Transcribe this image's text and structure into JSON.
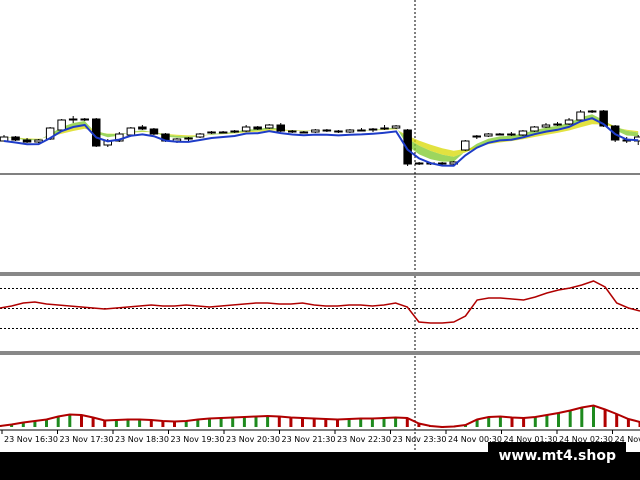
{
  "window": {
    "panels": [
      "main-price-chart",
      "oscillator-1",
      "oscillator-2"
    ]
  },
  "colors": {
    "background": "#ffffff",
    "bull_candle": "#ffffff",
    "bear_candle": "#000000",
    "ema_fast": "#1e3cc8",
    "ribbon_green": "#7cc828",
    "ribbon_yellow": "#d8d800",
    "oscillator_line": "#b00000",
    "histogram_pos": "#1e8a1e",
    "histogram_neg": "#b00000",
    "grid_dotted": "#000000",
    "crosshair": "#000000"
  },
  "x_axis": {
    "labels": [
      "23 Nov 16:30",
      "23 Nov 17:30",
      "23 Nov 18:30",
      "23 Nov 19:30",
      "23 Nov 20:30",
      "23 Nov 21:30",
      "23 Nov 22:30",
      "23 Nov 23:30",
      "24 Nov 00:30",
      "24 Nov 01:30",
      "24 Nov 02:30",
      "24 Nov 0"
    ]
  },
  "watermark": {
    "text": "www.mt4.shop"
  },
  "chart_data": {
    "type": "candlestick",
    "candles": [
      [
        0.48,
        0.6,
        0.47,
        0.56
      ],
      [
        0.56,
        0.58,
        0.48,
        0.5
      ],
      [
        0.5,
        0.54,
        0.44,
        0.46
      ],
      [
        0.46,
        0.52,
        0.44,
        0.5
      ],
      [
        0.52,
        0.76,
        0.5,
        0.74
      ],
      [
        0.7,
        0.92,
        0.66,
        0.9
      ],
      [
        0.9,
        0.98,
        0.84,
        0.92
      ],
      [
        0.92,
        0.94,
        0.88,
        0.92
      ],
      [
        0.92,
        0.94,
        0.36,
        0.38
      ],
      [
        0.4,
        0.52,
        0.36,
        0.48
      ],
      [
        0.48,
        0.66,
        0.46,
        0.62
      ],
      [
        0.6,
        0.76,
        0.58,
        0.74
      ],
      [
        0.76,
        0.8,
        0.7,
        0.72
      ],
      [
        0.72,
        0.74,
        0.6,
        0.62
      ],
      [
        0.62,
        0.64,
        0.46,
        0.48
      ],
      [
        0.48,
        0.54,
        0.44,
        0.52
      ],
      [
        0.52,
        0.56,
        0.48,
        0.54
      ],
      [
        0.56,
        0.64,
        0.54,
        0.62
      ],
      [
        0.64,
        0.68,
        0.62,
        0.66
      ],
      [
        0.66,
        0.68,
        0.64,
        0.66
      ],
      [
        0.66,
        0.7,
        0.64,
        0.68
      ],
      [
        0.68,
        0.8,
        0.66,
        0.76
      ],
      [
        0.76,
        0.78,
        0.7,
        0.72
      ],
      [
        0.74,
        0.82,
        0.72,
        0.8
      ],
      [
        0.8,
        0.84,
        0.66,
        0.68
      ],
      [
        0.68,
        0.7,
        0.64,
        0.66
      ],
      [
        0.66,
        0.68,
        0.64,
        0.66
      ],
      [
        0.66,
        0.72,
        0.64,
        0.7
      ],
      [
        0.7,
        0.72,
        0.66,
        0.68
      ],
      [
        0.68,
        0.7,
        0.64,
        0.66
      ],
      [
        0.66,
        0.72,
        0.64,
        0.7
      ],
      [
        0.7,
        0.74,
        0.68,
        0.7
      ],
      [
        0.7,
        0.74,
        0.66,
        0.72
      ],
      [
        0.72,
        0.8,
        0.7,
        0.74
      ],
      [
        0.74,
        0.8,
        0.72,
        0.78
      ],
      [
        0.7,
        0.72,
        -0.02,
        0.02
      ],
      [
        0.04,
        0.06,
        0.0,
        0.04
      ],
      [
        0.04,
        0.06,
        0.0,
        0.02
      ],
      [
        0.04,
        0.06,
        -0.02,
        0.02
      ],
      [
        0.02,
        0.08,
        0.0,
        0.06
      ],
      [
        0.3,
        0.5,
        0.28,
        0.48
      ],
      [
        0.56,
        0.6,
        0.52,
        0.58
      ],
      [
        0.58,
        0.64,
        0.56,
        0.62
      ],
      [
        0.62,
        0.64,
        0.6,
        0.62
      ],
      [
        0.62,
        0.66,
        0.58,
        0.6
      ],
      [
        0.6,
        0.7,
        0.58,
        0.68
      ],
      [
        0.68,
        0.78,
        0.66,
        0.76
      ],
      [
        0.76,
        0.84,
        0.74,
        0.8
      ],
      [
        0.8,
        0.86,
        0.78,
        0.82
      ],
      [
        0.82,
        0.94,
        0.8,
        0.9
      ],
      [
        0.9,
        1.1,
        0.88,
        1.06
      ],
      [
        1.06,
        1.1,
        1.04,
        1.08
      ],
      [
        1.08,
        1.1,
        0.76,
        0.78
      ],
      [
        0.78,
        0.8,
        0.46,
        0.5
      ],
      [
        0.5,
        0.56,
        0.44,
        0.48
      ],
      [
        0.48,
        0.6,
        0.4,
        0.56
      ]
    ],
    "osc1": [
      0.56,
      0.6,
      0.66,
      0.68,
      0.64,
      0.62,
      0.6,
      0.58,
      0.56,
      0.54,
      0.56,
      0.58,
      0.6,
      0.62,
      0.6,
      0.6,
      0.62,
      0.6,
      0.58,
      0.6,
      0.62,
      0.64,
      0.66,
      0.66,
      0.64,
      0.64,
      0.66,
      0.62,
      0.6,
      0.6,
      0.62,
      0.62,
      0.6,
      0.62,
      0.66,
      0.58,
      0.28,
      0.26,
      0.26,
      0.28,
      0.4,
      0.72,
      0.76,
      0.76,
      0.74,
      0.72,
      0.78,
      0.86,
      0.92,
      0.96,
      1.02,
      1.1,
      0.98,
      0.66,
      0.56,
      0.5
    ],
    "osc2": [
      0.04,
      0.1,
      0.18,
      0.24,
      0.3,
      0.42,
      0.5,
      0.48,
      0.38,
      0.26,
      0.28,
      0.3,
      0.3,
      0.28,
      0.24,
      0.22,
      0.24,
      0.3,
      0.34,
      0.36,
      0.38,
      0.4,
      0.42,
      0.44,
      0.42,
      0.38,
      0.36,
      0.34,
      0.32,
      0.3,
      0.32,
      0.34,
      0.34,
      0.36,
      0.38,
      0.36,
      0.14,
      0.04,
      0.0,
      0.02,
      0.08,
      0.3,
      0.4,
      0.42,
      0.38,
      0.36,
      0.4,
      0.48,
      0.56,
      0.66,
      0.78,
      0.86,
      0.7,
      0.52,
      0.32,
      0.2
    ],
    "osc1_levels": [
      0.95,
      0.55,
      0.15
    ]
  }
}
